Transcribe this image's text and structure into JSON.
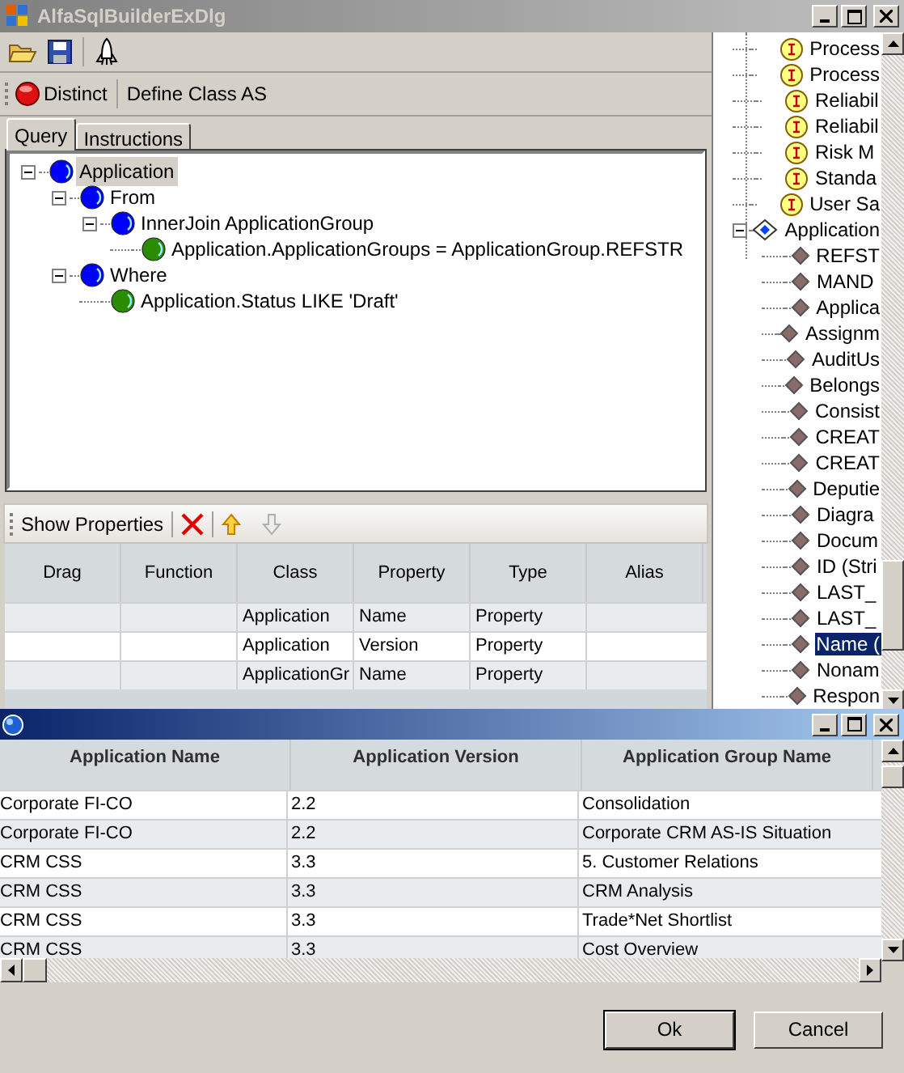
{
  "window": {
    "title": "AlfaSqlBuilderExDlg"
  },
  "command_bar": {
    "distinct": "Distinct",
    "define_class": "Define Class AS"
  },
  "tabs": [
    {
      "label": "Query",
      "selected": true
    },
    {
      "label": "Instructions",
      "selected": false
    }
  ],
  "query_tree": [
    {
      "kind": "node",
      "label": "Application",
      "selected": true,
      "expanded": true,
      "children": [
        {
          "kind": "node",
          "label": "From",
          "selected": false,
          "expanded": true,
          "children": [
            {
              "kind": "node",
              "label": "InnerJoin  ApplicationGroup",
              "selected": false,
              "expanded": true,
              "children": [
                {
                  "kind": "condition",
                  "label": "Application.ApplicationGroups = ApplicationGroup.REFSTR",
                  "selected": false
                }
              ]
            }
          ]
        },
        {
          "kind": "node",
          "label": "Where",
          "selected": false,
          "expanded": true,
          "children": [
            {
              "kind": "condition",
              "label": "Application.Status LIKE  'Draft'",
              "selected": false
            }
          ]
        }
      ]
    }
  ],
  "properties_toolbar": {
    "label": "Show Properties"
  },
  "properties_grid": {
    "columns": [
      "Drag",
      "Function",
      "Class",
      "Property",
      "Type",
      "Alias"
    ],
    "rows": [
      {
        "class": "Application",
        "property": "Name",
        "type": "Property"
      },
      {
        "class": "Application",
        "property": "Version",
        "type": "Property"
      },
      {
        "class": "ApplicationGr",
        "property": "Name",
        "type": "Property"
      }
    ]
  },
  "class_tree": [
    {
      "kind": "interface",
      "label": "Process",
      "selected": false
    },
    {
      "kind": "interface",
      "label": "Process",
      "selected": false
    },
    {
      "kind": "interface",
      "label": "Reliabil",
      "selected": false
    },
    {
      "kind": "interface",
      "label": "Reliabil",
      "selected": false
    },
    {
      "kind": "interface",
      "label": "Risk M",
      "selected": false
    },
    {
      "kind": "interface",
      "label": "Standa",
      "selected": false
    },
    {
      "kind": "interface",
      "label": "User Sa",
      "selected": false
    },
    {
      "kind": "class",
      "label": "Application",
      "selected": false,
      "expanded": true,
      "children": [
        {
          "kind": "property",
          "label": "REFST",
          "selected": false
        },
        {
          "kind": "property",
          "label": "MAND",
          "selected": false
        },
        {
          "kind": "property",
          "label": "Applica",
          "selected": false
        },
        {
          "kind": "property",
          "label": "Assignm",
          "selected": false
        },
        {
          "kind": "property",
          "label": "AuditUs",
          "selected": false
        },
        {
          "kind": "property",
          "label": "Belongs",
          "selected": false
        },
        {
          "kind": "property",
          "label": "Consist",
          "selected": false
        },
        {
          "kind": "property",
          "label": "CREAT",
          "selected": false
        },
        {
          "kind": "property",
          "label": "CREAT",
          "selected": false
        },
        {
          "kind": "property",
          "label": "Deputie",
          "selected": false
        },
        {
          "kind": "property",
          "label": "Diagra",
          "selected": false
        },
        {
          "kind": "property",
          "label": "Docum",
          "selected": false
        },
        {
          "kind": "property",
          "label": "ID (Stri",
          "selected": false
        },
        {
          "kind": "property",
          "label": "LAST_",
          "selected": false
        },
        {
          "kind": "property",
          "label": "LAST_",
          "selected": false
        },
        {
          "kind": "property",
          "label": "Name (",
          "selected": true
        },
        {
          "kind": "property",
          "label": "Nonam",
          "selected": false
        },
        {
          "kind": "property",
          "label": "Respon",
          "selected": false
        }
      ]
    }
  ],
  "results": {
    "columns": [
      "Application Name",
      "Application Version",
      "Application Group Name"
    ],
    "rows": [
      {
        "name": "Corporate FI-CO",
        "version": "2.2",
        "group": "Consolidation"
      },
      {
        "name": "Corporate FI-CO",
        "version": "2.2",
        "group": "Corporate CRM AS-IS Situation"
      },
      {
        "name": "CRM CSS",
        "version": "3.3",
        "group": "5. Customer Relations"
      },
      {
        "name": "CRM CSS",
        "version": "3.3",
        "group": "CRM Analysis"
      },
      {
        "name": "CRM CSS",
        "version": "3.3",
        "group": "Trade*Net Shortlist"
      },
      {
        "name": "CRM CSS",
        "version": "3.3",
        "group": "Cost Overview"
      }
    ]
  },
  "buttons": [
    {
      "label": "Ok",
      "kind": "default"
    },
    {
      "label": "Cancel",
      "kind": "normal"
    }
  ]
}
